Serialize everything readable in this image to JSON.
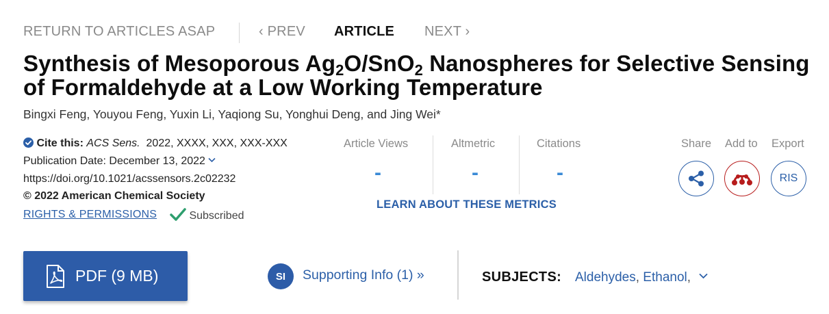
{
  "nav": {
    "return_label": "RETURN TO ARTICLES ASAP",
    "prev_label": "PREV",
    "article_label": "ARTICLE",
    "next_label": "NEXT"
  },
  "article": {
    "title_part1": "Synthesis of Mesoporous Ag",
    "title_sub1": "2",
    "title_part2": "O/SnO",
    "title_sub2": "2",
    "title_part3": " Nanospheres for Selective Sensing of Formaldehyde at a Low Working Temperature",
    "authors": "Bingxi Feng, Youyou Feng, Yuxin Li, Yaqiong Su, Yonghui Deng, and Jing Wei*"
  },
  "citation": {
    "cite_label": "Cite this:",
    "journal": "ACS Sens.",
    "details": "2022, XXXX, XXX, XXX-XXX",
    "pub_date": "Publication Date: December 13, 2022",
    "doi": "https://doi.org/10.1021/acssensors.2c02232",
    "copyright": "© 2022 American Chemical Society",
    "rights_label": "RIGHTS & PERMISSIONS",
    "subscribed_label": "Subscribed"
  },
  "metrics": {
    "items": [
      {
        "label": "Article Views",
        "value": "-"
      },
      {
        "label": "Altmetric",
        "value": "-"
      },
      {
        "label": "Citations",
        "value": "-"
      }
    ],
    "learn_label": "LEARN ABOUT THESE METRICS"
  },
  "actions": {
    "share_label": "Share",
    "add_label": "Add to",
    "export_label": "Export",
    "ris_label": "RIS"
  },
  "bottom": {
    "pdf_label": "PDF (9 MB)",
    "si_badge": "SI",
    "si_label": "Supporting Info (1) »",
    "subjects_label": "SUBJECTS:",
    "subjects": [
      "Aldehydes",
      "Ethanol"
    ]
  },
  "colors": {
    "accent": "#2b5fa8",
    "metric_value": "#3a8ad6",
    "mendeley_red": "#b71c1c",
    "subscribed_green": "#2e9e6e"
  }
}
